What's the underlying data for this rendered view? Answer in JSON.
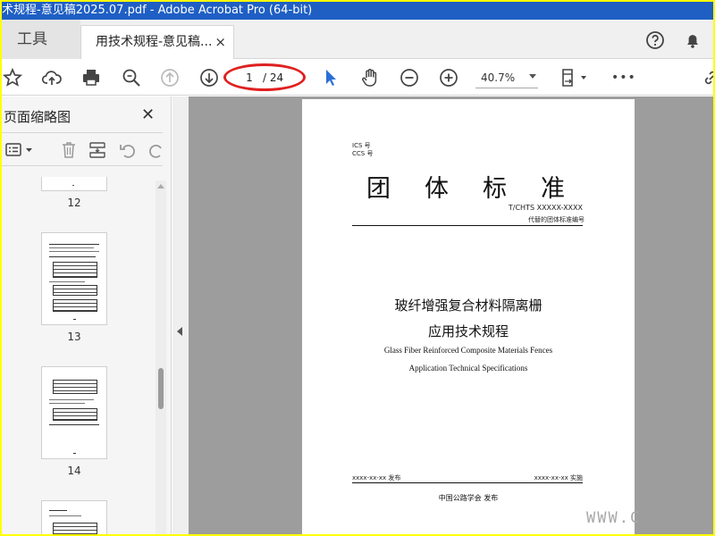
{
  "window": {
    "title": "术规程-意见稿2025.07.pdf - Adobe Acrobat Pro (64-bit)"
  },
  "tabs": {
    "tools_label": "工具",
    "document_tab_label": "用技术规程-意见稿...",
    "close_glyph": "×"
  },
  "toolbar": {
    "current_page": "1",
    "page_total": "/ 24",
    "zoom": "40.7%",
    "more_glyph": "•••"
  },
  "thumbnail_panel": {
    "title": "页面缩略图",
    "close_glyph": "✕",
    "thumbnails": [
      {
        "label": "12"
      },
      {
        "label": "13"
      },
      {
        "label": "14"
      }
    ]
  },
  "document_page": {
    "ics": "ICS 号",
    "ccs": "CCS 号",
    "standard_title": "团体标准",
    "standard_code": "T/CHTS  XXXXX-XXXX",
    "replace_note": "代替的团体标准编号",
    "cn_title_line1": "玻纤增强复合材料隔离栅",
    "cn_title_line2": "应用技术规程",
    "en_title_line1": "Glass Fiber Reinforced Composite Materials Fences",
    "en_title_line2": "Application Technical Specifications",
    "publish_date": "xxxx-xx-xx 发布",
    "implement_date": "xxxx-xx-xx 实施",
    "publisher": "中国公路学会  发布"
  },
  "watermark": "WWW.C",
  "colors": {
    "titlebar": "#1f5fc4",
    "highlight_ellipse": "#e02020",
    "frame": "#ffff00",
    "pointer_tool": "#2a6fd6"
  }
}
